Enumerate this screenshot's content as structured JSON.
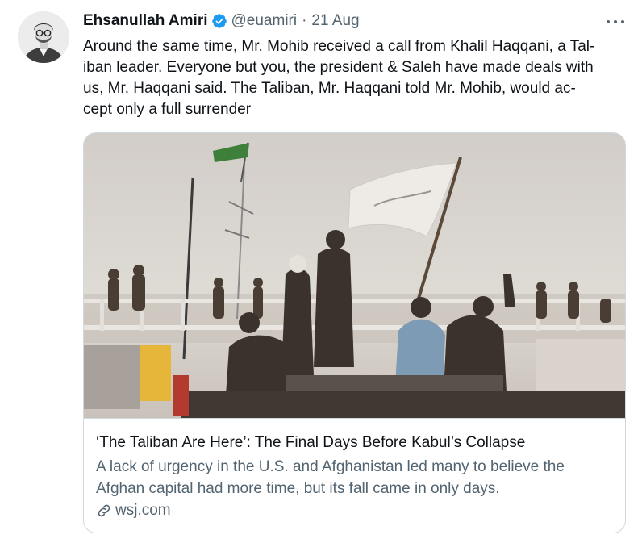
{
  "author": {
    "name": "Ehsanullah Amiri",
    "handle": "@euamiri",
    "separator": "·",
    "date": "21 Aug",
    "verified": true
  },
  "tweet": {
    "lines": [
      "Around the same time, Mr. Mohib received a call from Khalil Haqqani, a Tal-",
      "iban leader. Everyone but you, the president & Saleh have made deals with",
      "us, Mr. Haqqani said. The Taliban, Mr. Haqqani told Mr. Mohib, would ac-",
      "cept only a full surrender"
    ]
  },
  "card": {
    "title": "‘The Taliban Are Here’: The Final Days Before Kabul’s Collapse",
    "description_lines": [
      "A lack of urgency in the U.S. and Afghanistan led many to believe the",
      "Afghan capital had more time, but its fall came in only days."
    ],
    "domain": "wsj.com",
    "domain_icon": "link-icon",
    "image_alt": "Taliban fighters with a white flag atop a vehicle"
  },
  "icons": {
    "verified": "verified-badge-icon",
    "more": "more-options-icon"
  },
  "colors": {
    "text_primary": "#0f1419",
    "text_secondary": "#536471",
    "verified_blue": "#1d9bf0",
    "border": "#cfd9de"
  }
}
